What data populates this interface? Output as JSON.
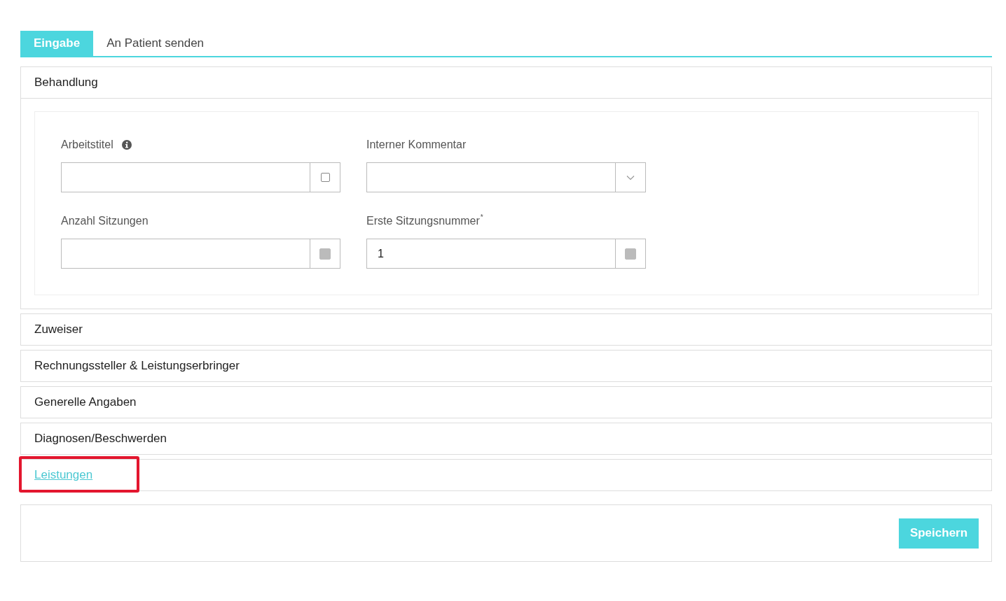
{
  "tabs": [
    {
      "label": "Eingabe",
      "selected": true
    },
    {
      "label": "An Patient senden",
      "selected": false
    }
  ],
  "sections": [
    {
      "title": "Behandlung",
      "kind": "panel",
      "fields": [
        {
          "label": "Arbeitstitel",
          "info": true,
          "kind": "text",
          "disabled": false
        },
        {
          "label": "Interner Kommentar",
          "kind": "select"
        },
        {
          "label": "Anzahl Sitzungen",
          "kind": "text",
          "disabled": true
        },
        {
          "label": "Erste Sitzungsnummer",
          "required_mark": "*",
          "value": "1",
          "kind": "text",
          "disabled": true
        }
      ]
    },
    {
      "title": "Zuweiser",
      "kind": "panel"
    },
    {
      "title": "Rechnungssteller & Leistungserbringer",
      "kind": "panel"
    },
    {
      "title": "Generelle Angaben",
      "kind": "panel"
    },
    {
      "title": "Diagnosen/Beschwerden",
      "kind": "panel"
    },
    {
      "title": "Leistungen",
      "kind": "link",
      "highlighted": true
    }
  ],
  "save_button": "Speichern"
}
